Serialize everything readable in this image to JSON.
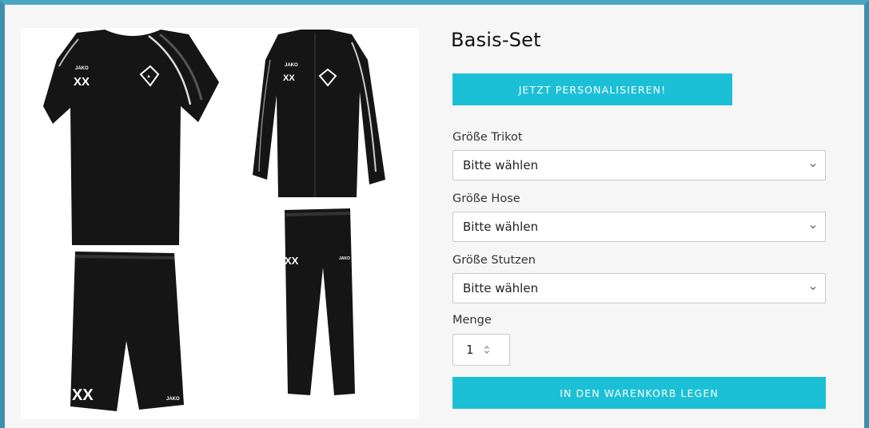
{
  "product": {
    "title": "Basis-Set",
    "image": {
      "shirt_brand": "JAKO",
      "shirt_number": "XX",
      "jacket_brand": "JAKO",
      "jacket_number": "XX",
      "shorts_number": "XX",
      "shorts_brand": "JAKO",
      "pants_number": "XX",
      "pants_brand": "JAKO"
    }
  },
  "personalize_button": "JETZT PERSONALISIEREN!",
  "options": [
    {
      "label": "Größe Trikot",
      "value": "Bitte wählen"
    },
    {
      "label": "Größe Hose",
      "value": "Bitte wählen"
    },
    {
      "label": "Größe Stutzen",
      "value": "Bitte wählen"
    }
  ],
  "quantity": {
    "label": "Menge",
    "value": "1"
  },
  "cart_button": "IN DEN WARENKORB LEGEN",
  "colors": {
    "accent": "#1cc0d6",
    "frame": "#3d8fae"
  }
}
